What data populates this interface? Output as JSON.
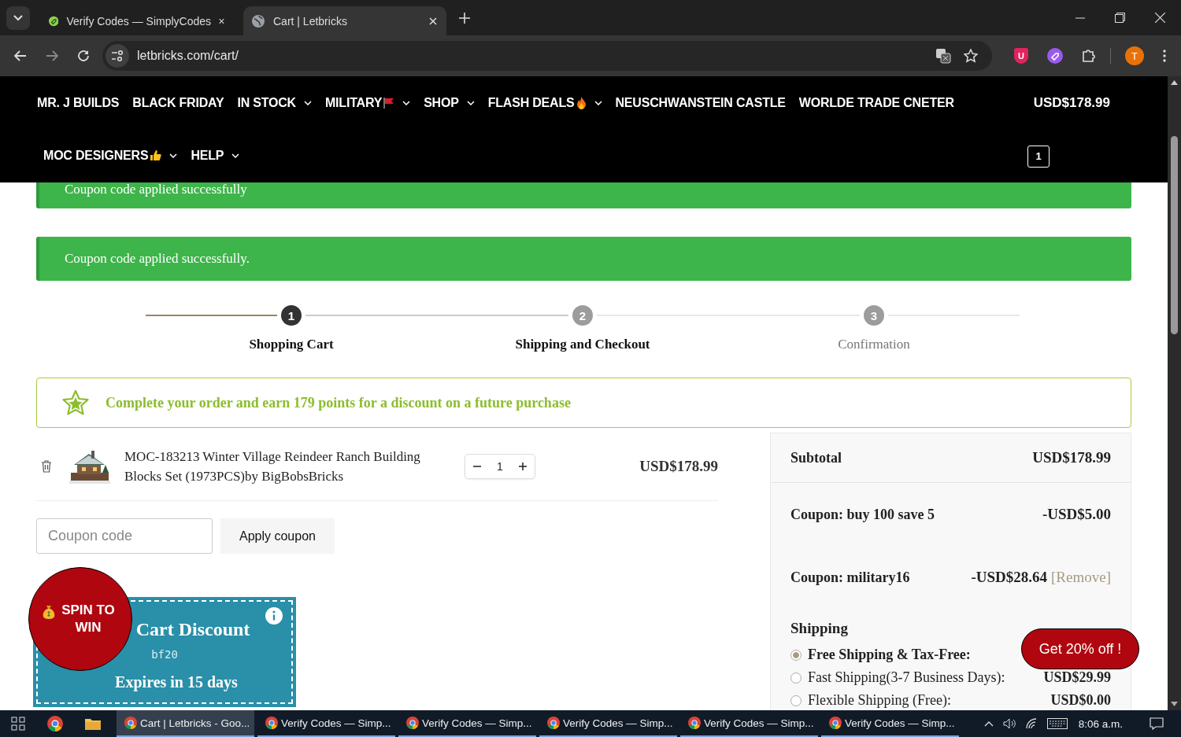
{
  "browser": {
    "tabs": [
      {
        "title": "Verify Codes — SimplyCodes",
        "selected": false
      },
      {
        "title": "Cart | Letbricks",
        "selected": true
      }
    ],
    "url": "letbricks.com/cart/",
    "shield_letter": "U",
    "profile_initial": "T"
  },
  "nav": {
    "rows": [
      [
        {
          "label": "MR. J BUILDS",
          "kind": "plain",
          "dropdown": false
        },
        {
          "label": "BLACK FRIDAY",
          "kind": "plain",
          "dropdown": false
        },
        {
          "label": "IN STOCK",
          "kind": "plain",
          "dropdown": true
        },
        {
          "label": "MILITARY",
          "kind": "flag",
          "dropdown": true
        },
        {
          "label": "SHOP",
          "kind": "plain",
          "dropdown": true
        },
        {
          "label": "FLASH DEALS",
          "kind": "fire",
          "dropdown": true
        },
        {
          "label": "NEUSCHWANSTEIN CASTLE",
          "kind": "plain",
          "dropdown": false
        },
        {
          "label": "WORLDE TRADE CNETER",
          "kind": "plain",
          "dropdown": false
        }
      ],
      [
        {
          "label": "MOC DESIGNERS",
          "kind": "thumb",
          "dropdown": true
        },
        {
          "label": "HELP",
          "kind": "plain",
          "dropdown": true
        }
      ]
    ],
    "cart_total": "USD$178.99",
    "cart_count": "1"
  },
  "notices": [
    "Coupon code applied successfully",
    "Coupon code applied successfully."
  ],
  "steps": [
    {
      "number": "1",
      "label": "Shopping Cart",
      "selected": true
    },
    {
      "number": "2",
      "label": "Shipping and Checkout",
      "selected": false
    },
    {
      "number": "3",
      "label": "Confirmation",
      "selected": false
    }
  ],
  "points_message": "Complete your order and earn 179 points for a discount on a future purchase",
  "cart_items": [
    {
      "name": "MOC-183213 Winter Village Reindeer Ranch Building Blocks Set (1973PCS)by BigBobsBricks",
      "quantity": "1",
      "price": "USD$178.99"
    }
  ],
  "coupon": {
    "placeholder": "Coupon code",
    "button": "Apply coupon"
  },
  "discount_card": {
    "title": "Cart Discount",
    "code": "bf20",
    "expiry": "Expires in 15 days"
  },
  "spin_badge": "SPIN TO WIN",
  "totals": {
    "subtotal_label": "Subtotal",
    "subtotal": "USD$178.99",
    "coupons": [
      {
        "label": "Coupon: buy 100 save 5",
        "amount": "-USD$5.00"
      },
      {
        "label": "Coupon: military16",
        "amount": "-USD$28.64",
        "remove": "[Remove]"
      }
    ],
    "shipping_label": "Shipping",
    "shipping_options": [
      {
        "label": "Free Shipping & Tax-Free:",
        "selected": true
      },
      {
        "label": "Fast Shipping(3-7 Business Days):",
        "price": "USD$29.99",
        "selected": false
      },
      {
        "label": "Flexible Shipping (Free):",
        "price": "USD$0.00",
        "selected": false
      }
    ]
  },
  "promo_button": "Get 20% off !",
  "taskbar": {
    "windows": [
      {
        "title": "Cart | Letbricks - Goo...",
        "selected": true
      },
      {
        "title": "Verify Codes — Simp...",
        "selected": false
      },
      {
        "title": "Verify Codes — Simp...",
        "selected": false
      },
      {
        "title": "Verify Codes — Simp...",
        "selected": false
      },
      {
        "title": "Verify Codes — Simp...",
        "selected": false
      },
      {
        "title": "Verify Codes — Simp...",
        "selected": false
      }
    ],
    "clock": "8:06 a.m."
  }
}
